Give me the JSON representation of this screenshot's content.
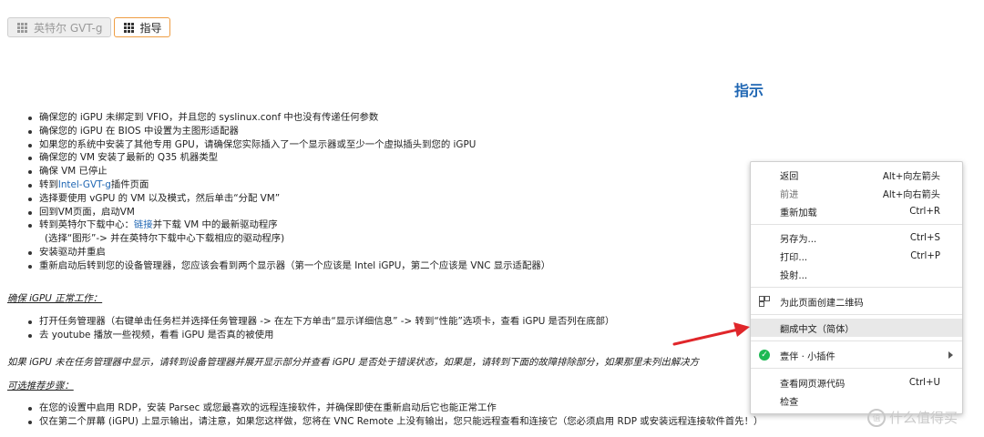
{
  "tabs": [
    {
      "label": "英特尔 GVT-g",
      "icon": "grid-icon",
      "active": false
    },
    {
      "label": "指导",
      "icon": "grid-icon",
      "active": true
    }
  ],
  "page": {
    "title": "指示",
    "steps": [
      "确保您的 iGPU 未绑定到 VFIO，并且您的 syslinux.conf 中也没有传递任何参数",
      "确保您的 iGPU 在 BIOS 中设置为主图形适配器",
      "如果您的系统中安装了其他专用 GPU，请确保您实际插入了一个显示器或至少一个虚拟插头到您的 iGPU",
      "确保您的 VM 安装了最新的 Q35 机器类型",
      "确保 VM 已停止",
      {
        "pre": "转到",
        "link": "Intel-GVT-g",
        "post": "插件页面"
      },
      "选择要使用 vGPU 的 VM 以及模式，然后单击“分配 VM”",
      "回到VM页面，启动VM",
      {
        "pre": "转到英特尔下载中心：",
        "link": "链接",
        "post": "并下载 VM 中的最新驱动程序",
        "sub": "(选择“图形”-> 并在英特尔下载中心下载相应的驱动程序)"
      },
      "安装驱动并重启",
      "重新启动后转到您的设备管理器，您应该会看到两个显示器（第一个应该是 Intel iGPU，第二个应该是 VNC 显示适配器）"
    ],
    "verify_heading": "确保 iGPU 正常工作：",
    "verify_steps": [
      "打开任务管理器（右键单击任务栏并选择任务管理器 -> 在左下方单击“显示详细信息” -> 转到“性能”选项卡，查看 iGPU 是否列在底部）",
      "去 youtube 播放一些视频，看看 iGPU 是否真的被使用"
    ],
    "troubleshoot_note": "如果 iGPU 未在任务管理器中显示，请转到设备管理器并展开显示部分并查看 iGPU 是否处于错误状态，如果是，请转到下面的故障排除部分，如果那里未列出解决方",
    "optional_heading": "可选推荐步骤：",
    "optional_steps": [
      "在您的设置中启用 RDP，安装 Parsec 或您最喜欢的远程连接软件，并确保即使在重新启动后它也能正常工作",
      "仅在第二个屏幕 (iGPU) 上显示输出，请注意，如果您这样做，您将在 VNC Remote 上没有输出，您只能远程查看和连接它（您必须启用 RDP 或安装远程连接软件首先！）"
    ]
  },
  "context_menu": {
    "back": {
      "label": "返回",
      "shortcut": "Alt+向左箭头"
    },
    "forward": {
      "label": "前进",
      "shortcut": "Alt+向右箭头",
      "disabled": true
    },
    "reload": {
      "label": "重新加载",
      "shortcut": "Ctrl+R"
    },
    "save_as": {
      "label": "另存为...",
      "shortcut": "Ctrl+S"
    },
    "print": {
      "label": "打印...",
      "shortcut": "Ctrl+P"
    },
    "cast": {
      "label": "投射..."
    },
    "qr": {
      "label": "为此页面创建二维码",
      "icon": "qr-code-icon"
    },
    "translate": {
      "label": "翻成中文（简体）"
    },
    "extension": {
      "label": "壹伴 · 小插件",
      "icon": "extension-icon"
    },
    "view_source": {
      "label": "查看网页源代码",
      "shortcut": "Ctrl+U"
    },
    "inspect": {
      "label": "检查"
    }
  },
  "annotation": {
    "color": "#e0262a",
    "icon": "red-arrow-icon"
  },
  "watermark": {
    "text": "什么值得买",
    "logo_glyph": "值"
  },
  "colors": {
    "link": "#1f66b3",
    "active_tab_border": "#ef9d43"
  }
}
